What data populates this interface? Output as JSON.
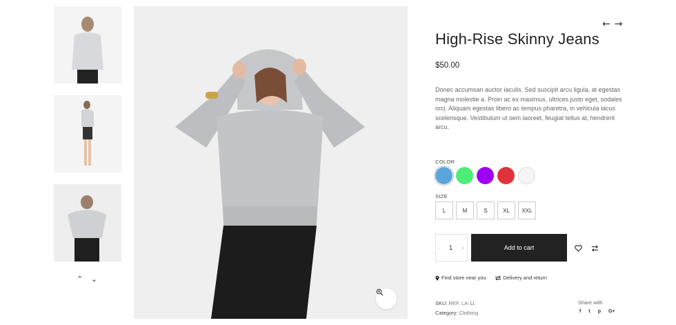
{
  "product": {
    "title": "High-Rise Skinny Jeans",
    "price": "$50.00",
    "description": "Donec accumsan auctor iaculis. Sed suscipit arcu ligula, at egestas magna molestie a. Proin ac ex maximus, ultrices justo eget, sodales orci. Aliquam egestas libero ac tempus pharetra, in vehicula lacus scelerisque. Vestibulum ut sem laoreet, feugiat tellus at, hendrerit arcu."
  },
  "navigation": {
    "prev_icon": "arrow-left-icon",
    "next_icon": "arrow-right-icon",
    "prev": "←",
    "next": "→"
  },
  "gallery": {
    "up": "⌃",
    "down": "⌄",
    "zoom_icon": "zoom-in-icon"
  },
  "color": {
    "label": "COLOR",
    "options": [
      "#59a5dc",
      "#4cee77",
      "#9d00f4",
      "#e0323a",
      "#f5f5f5"
    ]
  },
  "size": {
    "label": "SIZE",
    "options": [
      "L",
      "M",
      "S",
      "XL",
      "XXL"
    ]
  },
  "cart": {
    "quantity": "1",
    "minus": "-",
    "plus": "+",
    "add_label": "Add to cart",
    "wishlist_icon": "heart-icon",
    "compare_icon": "compare-icon"
  },
  "links": {
    "store": "Find store near you",
    "delivery": "Delivery and return"
  },
  "meta": {
    "sku_label": "SKU:",
    "sku_value": "REF. LA-11",
    "category_label": "Category:",
    "category_value": "Clothing"
  },
  "share": {
    "label": "Share with",
    "icons": [
      "f",
      "t",
      "p",
      "G+"
    ]
  }
}
